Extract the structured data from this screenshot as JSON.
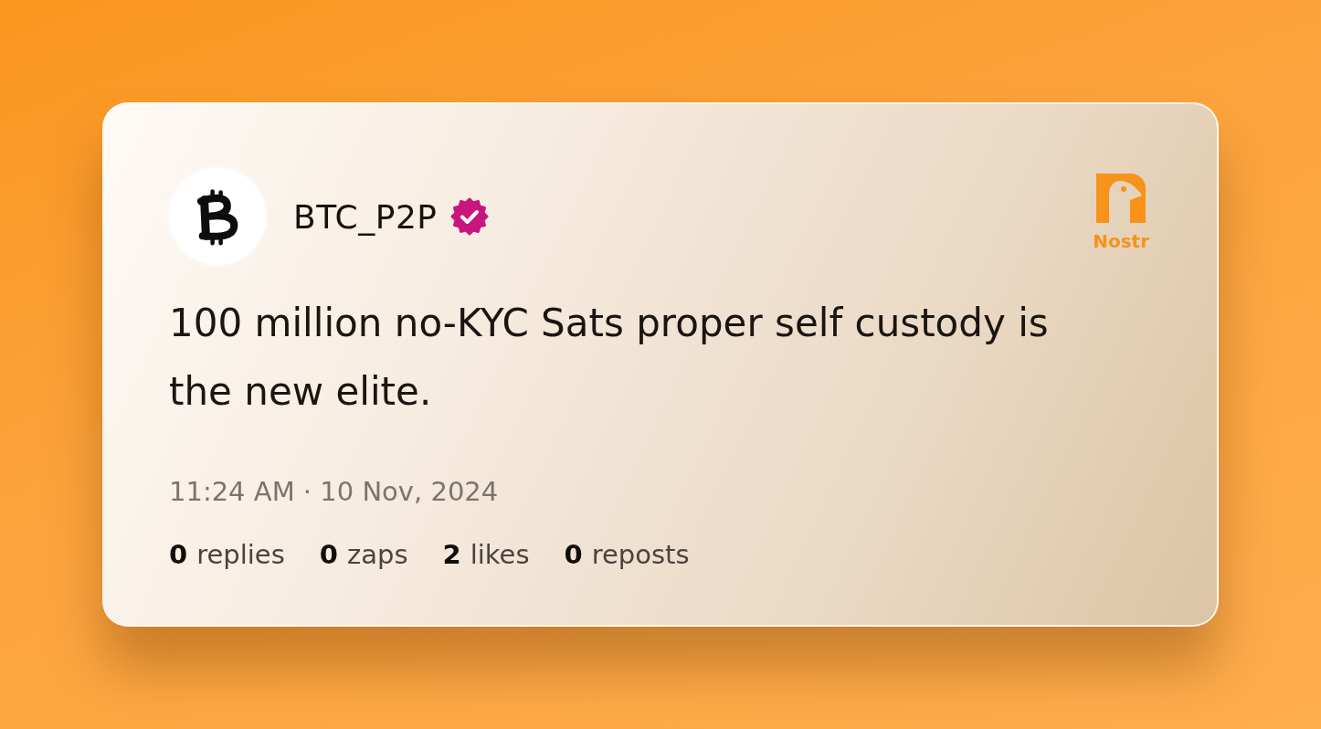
{
  "post": {
    "author": {
      "name": "BTC_P2P",
      "verified": true
    },
    "platform": {
      "label": "Nostr"
    },
    "text": "100 million no-KYC Sats proper self custody is the new elite.",
    "timestamp": "11:24 AM · 10 Nov, 2024",
    "stats": [
      {
        "count": "0",
        "label": "replies"
      },
      {
        "count": "0",
        "label": "zaps"
      },
      {
        "count": "2",
        "label": "likes"
      },
      {
        "count": "0",
        "label": "reposts"
      }
    ]
  }
}
